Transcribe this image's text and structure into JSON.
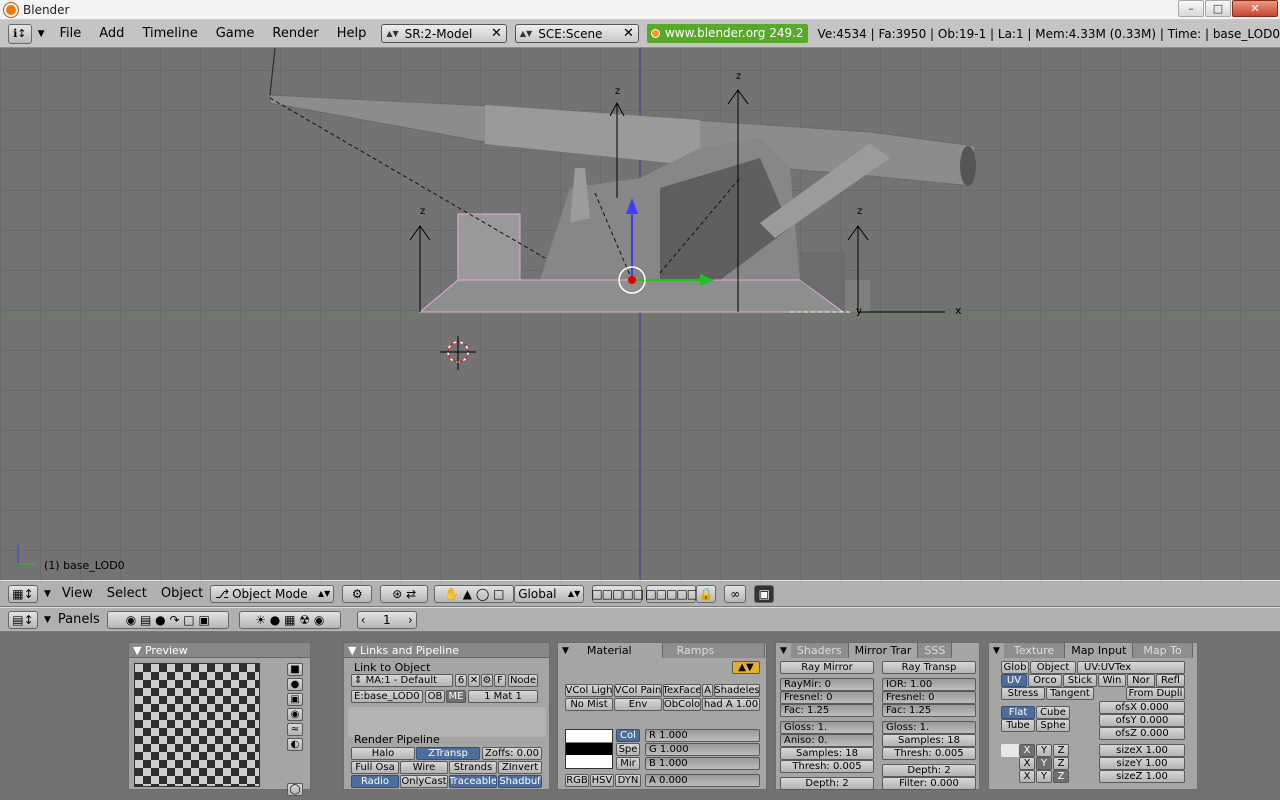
{
  "window": {
    "title": "Blender"
  },
  "info_header": {
    "menus": [
      "File",
      "Add",
      "Timeline",
      "Game",
      "Render",
      "Help"
    ],
    "screen": "SR:2-Model",
    "scene": "SCE:Scene",
    "weblink": "www.blender.org 249.2",
    "stats": "Ve:4534 | Fa:3950 | Ob:19-1 | La:1  | Mem:4.33M (0.33M) | Time: | base_LOD0"
  },
  "viewport": {
    "object_label": "(1) base_LOD0",
    "axis_labels": {
      "z": "z",
      "x": "x",
      "y": "y"
    }
  },
  "view3d_header": {
    "menus": [
      "View",
      "Select",
      "Object"
    ],
    "mode": "Object Mode",
    "orientation": "Global"
  },
  "buttons_header": {
    "panels_label": "Panels",
    "frame": "1"
  },
  "preview_panel": {
    "title": "Preview"
  },
  "links_panel": {
    "title": "Links and Pipeline",
    "link_to_object": "Link to Object",
    "material": "MA:1 - Default",
    "users": "6",
    "f": "F",
    "node": "Node",
    "object": "E:base_LOD0",
    "ob": "OB",
    "me": "ME",
    "mat_count": "1 Mat 1",
    "render_pipeline": "Render Pipeline",
    "pipeline_buttons": [
      "Halo",
      "ZTransp",
      "Zoffs: 0.00",
      "Full Osa",
      "Wire",
      "Strands",
      "ZInvert",
      "Radio",
      "OnlyCast",
      "Traceable",
      "Shadbuf"
    ]
  },
  "material_panel": {
    "tabs": [
      "Material",
      "Ramps"
    ],
    "row1": [
      "VCol Ligh",
      "VCol Pain",
      "TexFace",
      "A",
      "Shadeles"
    ],
    "row2": [
      "No Mist",
      "Env",
      "ObColo",
      "had A 1.00"
    ],
    "color_tabs": [
      "Col",
      "Spe",
      "Mir"
    ],
    "rgb": [
      "R 1.000",
      "G 1.000",
      "B 1.000",
      "A 0.000"
    ],
    "modes": [
      "RGB",
      "HSV",
      "DYN"
    ]
  },
  "shaders_panel": {
    "tabs": [
      "Shaders",
      "Mirror Trar",
      "SSS"
    ],
    "ray_mirror": "Ray Mirror",
    "ray_transp": "Ray Transp",
    "left": [
      "RayMir: 0",
      "Fresnel: 0",
      "Fac: 1.25",
      "Gloss: 1.",
      "Aniso: 0.",
      "Samples: 18",
      "Thresh: 0.005",
      "Depth: 2"
    ],
    "right": [
      "IOR: 1.00",
      "Fresnel: 0",
      "Fac: 1.25",
      "Gloss: 1.",
      "Samples: 18",
      "Thresh: 0.005",
      "Depth: 2",
      "Filter: 0.000"
    ]
  },
  "texture_panel": {
    "tabs": [
      "Texture",
      "Map Input",
      "Map To"
    ],
    "row1": [
      "Glob",
      "Object",
      "UV:UVTex"
    ],
    "row2": [
      "UV",
      "Orco",
      "Stick",
      "Win",
      "Nor",
      "Refl"
    ],
    "row3": [
      "Stress",
      "Tangent",
      "From Dupli"
    ],
    "proj": [
      "Flat",
      "Cube",
      "Tube",
      "Sphe"
    ],
    "ofs": [
      "ofsX 0.000",
      "ofsY 0.000",
      "ofsZ 0.000"
    ],
    "size": [
      "sizeX 1.00",
      "sizeY 1.00",
      "sizeZ 1.00"
    ],
    "xyz": [
      "X",
      "Y",
      "Z"
    ]
  }
}
